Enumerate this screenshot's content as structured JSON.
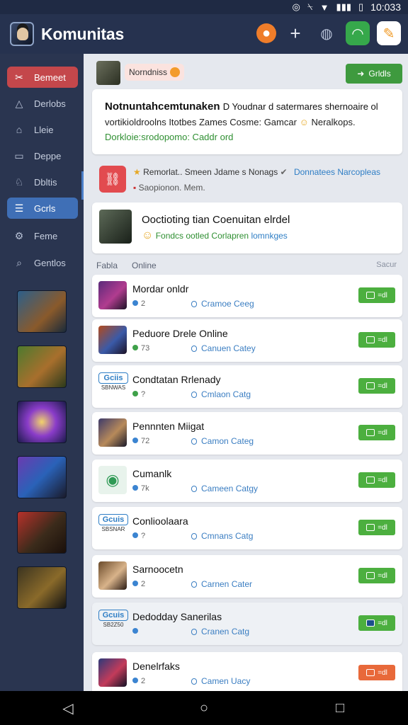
{
  "status_bar": {
    "time": "10:033",
    "icons": [
      "target-icon",
      "silent-icon",
      "wifi-icon",
      "signal-icon",
      "battery-icon"
    ]
  },
  "app_bar": {
    "title": "Komunitas"
  },
  "sidebar": {
    "items": [
      {
        "label": "Bemeet",
        "icon": "scissors-icon"
      },
      {
        "label": "Derlobs",
        "icon": "triangle-icon"
      },
      {
        "label": "Lleie",
        "icon": "home-icon"
      },
      {
        "label": "Deppe",
        "icon": "calendar-icon"
      },
      {
        "label": "Dbltis",
        "icon": "gamepad-icon"
      },
      {
        "label": "Gcrls",
        "icon": "list-icon"
      },
      {
        "label": "Feme",
        "icon": "gear-icon"
      },
      {
        "label": "Gentlos",
        "icon": "search-icon"
      }
    ]
  },
  "top_notice": {
    "pill_text": "Norndniss",
    "button_label": "Grldls"
  },
  "announcement": {
    "heading": "Notnuntahcemtunaken",
    "heading_rest": "D Youdnar d satermares shernoaire ol",
    "body": "vortikioldroolns Itotbes Zames Cosme: Gamcar",
    "body_tail": "Neralkops.",
    "footer": "Dorkloie:srodopomo: Caddr",
    "footer_tail": "ord"
  },
  "news": {
    "line1": "Remorlat.. Smeen Jdame s Nonags",
    "line1_link": "Donnatees Narcopleas",
    "line2": "Saopionon. Mem."
  },
  "feature": {
    "heading": "Ooctioting tian Coenuitan elrdel",
    "sub": "Fondcs ootled Corlapren",
    "sub_tail": "lomnkges"
  },
  "list_header": {
    "col1": "Fabla",
    "col2": "Online",
    "col3": "Sacur"
  },
  "rows": [
    {
      "name": "Mordar onldr",
      "meta": "2",
      "category": "Cramoe Ceeg",
      "button": "=dl",
      "dim": false
    },
    {
      "name": "Peduore Drele Online",
      "meta": "73",
      "category": "Canuen Catey",
      "button": "=dl",
      "dim": false
    },
    {
      "name": "Condtatan Rrlenady",
      "meta": "?",
      "category": "Cmlaon Catg",
      "button": "=dl",
      "dim": false,
      "logo": "Gciis",
      "logo_small": "SBNWAS"
    },
    {
      "name": "Pennnten Miigat",
      "meta": "72",
      "category": "Camon Categ",
      "button": "=dl",
      "dim": false
    },
    {
      "name": "Cumanlk",
      "meta": "7k",
      "category": "Cameen Catgy",
      "button": "=dl",
      "dim": false
    },
    {
      "name": "Conlioolaara",
      "meta": "?",
      "category": "Cmnans Catg",
      "button": "=dl",
      "dim": false,
      "logo": "Gcuis",
      "logo_small": "SBSNAR"
    },
    {
      "name": "Sarnoocetn",
      "meta": "2",
      "category": "Carnen Cater",
      "button": "=dl",
      "dim": false
    },
    {
      "name": "Dedodday Sanerilas",
      "meta": "",
      "category": "Cranen Catg",
      "button": "=dl",
      "dim": true,
      "logo": "Gcuis",
      "logo_small": "SB2Z50"
    },
    {
      "name": "Denelrfaks",
      "meta": "2",
      "category": "Camen Uacy",
      "button": "=dl",
      "dim": false
    }
  ]
}
